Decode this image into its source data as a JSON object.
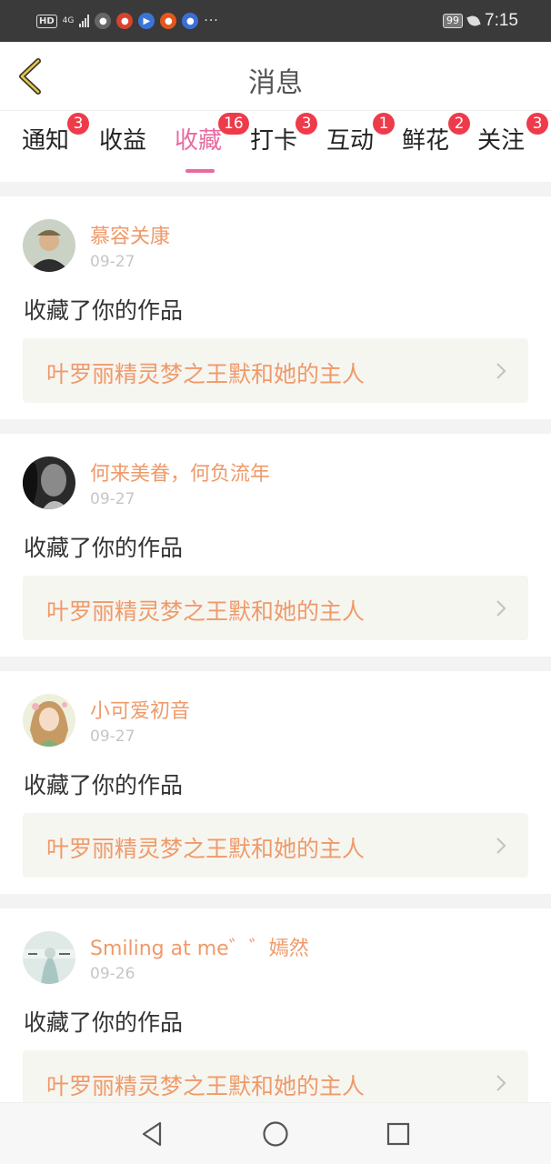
{
  "status_bar": {
    "network": "HD",
    "network_type": "4G",
    "battery": "99",
    "time": "7:15",
    "more": "···"
  },
  "header": {
    "title": "消息",
    "back_icon": "chevron-left-icon",
    "accent_color": "#e86aa0"
  },
  "tabs": [
    {
      "label": "通知",
      "badge": "3"
    },
    {
      "label": "收益",
      "badge": ""
    },
    {
      "label": "收藏",
      "badge": "16",
      "active": true
    },
    {
      "label": "打卡",
      "badge": "3"
    },
    {
      "label": "互动",
      "badge": "1"
    },
    {
      "label": "鲜花",
      "badge": "2"
    },
    {
      "label": "关注",
      "badge": "3"
    }
  ],
  "messages": [
    {
      "user": "慕容关康",
      "date": "09-27",
      "action": "收藏了你的作品",
      "work": "叶罗丽精灵梦之王默和她的主人"
    },
    {
      "user": "何来美眷，何负流年",
      "date": "09-27",
      "action": "收藏了你的作品",
      "work": "叶罗丽精灵梦之王默和她的主人"
    },
    {
      "user": "小可爱初音",
      "date": "09-27",
      "action": "收藏了你的作品",
      "work": "叶罗丽精灵梦之王默和她的主人"
    },
    {
      "user": "Smiling at me゛゛嫣然",
      "date": "09-26",
      "action": "收藏了你的作品",
      "work": "叶罗丽精灵梦之王默和她的主人"
    }
  ],
  "nav": {
    "back_icon": "triangle-back-icon",
    "home_icon": "circle-home-icon",
    "recents_icon": "square-recents-icon"
  }
}
